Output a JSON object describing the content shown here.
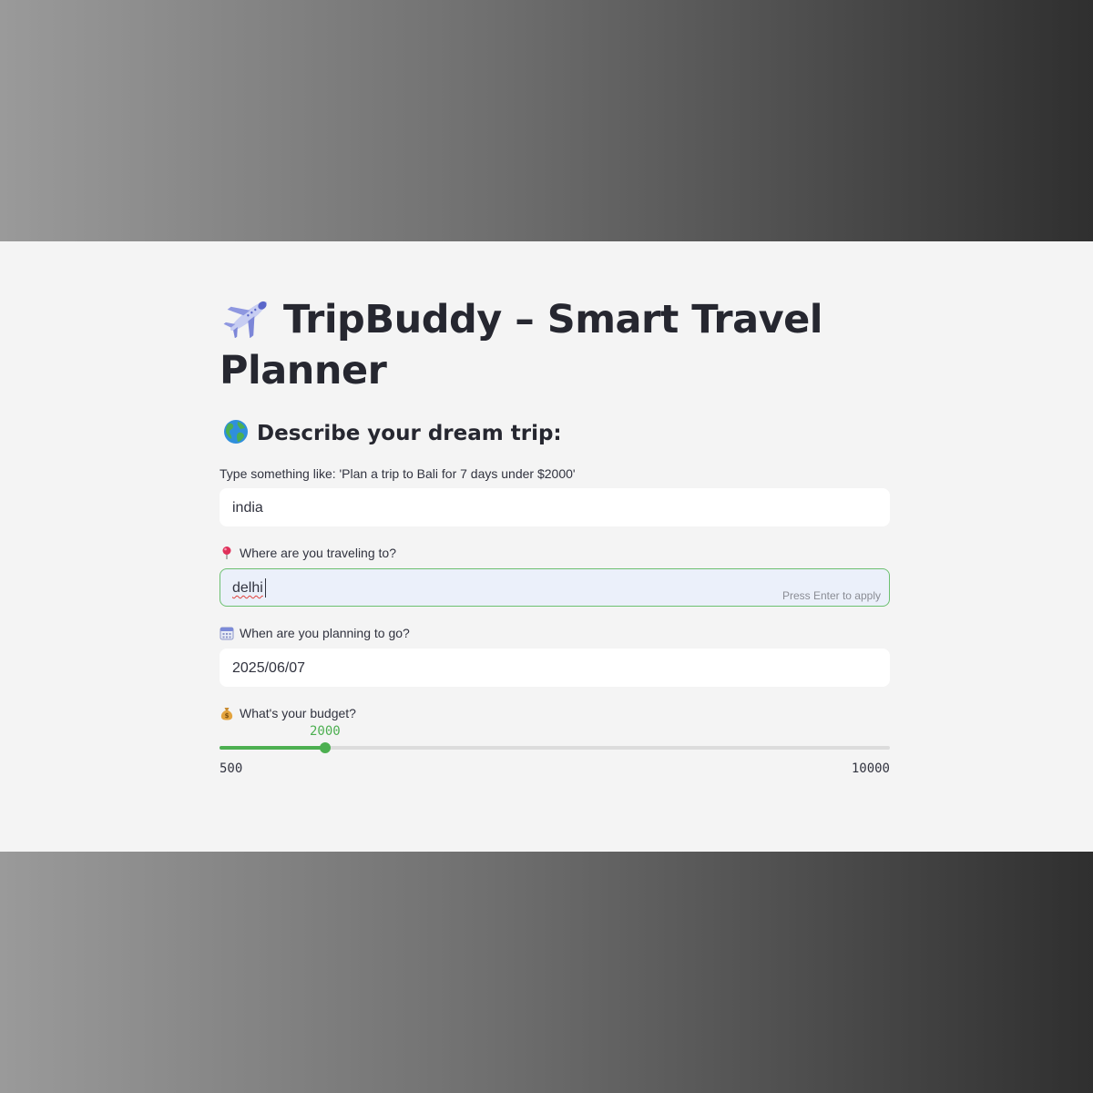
{
  "app": {
    "title": "TripBuddy – Smart Travel Planner",
    "title_icon": "airplane-icon"
  },
  "section": {
    "heading": "Describe your dream trip:",
    "heading_icon": "globe-icon"
  },
  "prompt_field": {
    "label": "Type something like: 'Plan a trip to Bali for 7 days under $2000'",
    "value": "india"
  },
  "destination_field": {
    "label": "Where are you traveling to?",
    "label_icon": "pin-icon",
    "value": "delhi",
    "hint": "Press Enter to apply"
  },
  "date_field": {
    "label": "When are you planning to go?",
    "label_icon": "calendar-icon",
    "value": "2025/06/07"
  },
  "budget_slider": {
    "label": "What's your budget?",
    "label_icon": "money-bag-icon",
    "value": 2000,
    "value_text": "2000",
    "min": 500,
    "max": 10000,
    "min_text": "500",
    "max_text": "10000"
  },
  "colors": {
    "accent": "#4caf50",
    "focus_border": "#6cc070",
    "text": "#262730",
    "panel_bg": "#f4f4f4"
  }
}
